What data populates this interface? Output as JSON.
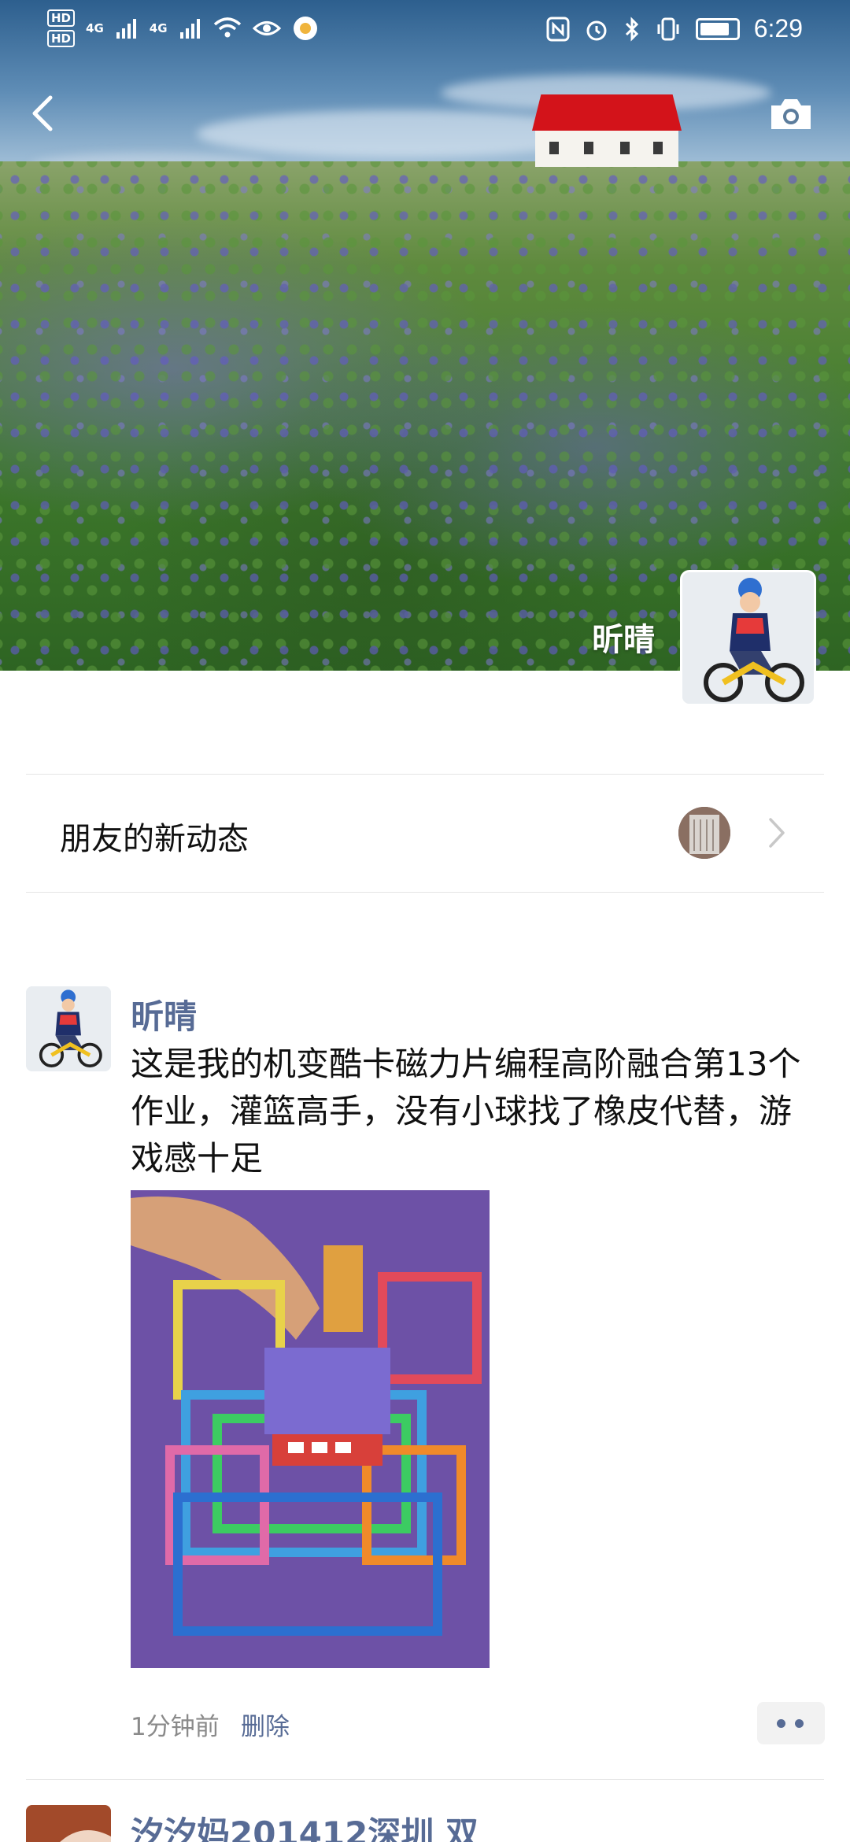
{
  "status_bar": {
    "network_left": [
      "HD",
      "HD"
    ],
    "network_labels": [
      "4G",
      "4G"
    ],
    "time": "6:29"
  },
  "profile": {
    "name": "昕晴"
  },
  "friends_updates": {
    "label": "朋友的新动态"
  },
  "post": {
    "author": "昕晴",
    "text": "这是我的机变酷卡磁力片编程高阶融合第13个作业，灌篮高手，没有小球找了橡皮代替，游戏感十足",
    "time_ago": "1分钟前",
    "delete_label": "删除"
  },
  "next_post": {
    "author": "汐汐妈201412深圳 双"
  },
  "icons": {
    "back": "back-arrow-icon",
    "camera": "camera-icon",
    "chevron": "chevron-right-icon",
    "more": "more-dots-icon"
  },
  "colors": {
    "link_blue": "#576b95",
    "secondary_text": "#8a8a8a",
    "divider": "#e5e5e5"
  }
}
